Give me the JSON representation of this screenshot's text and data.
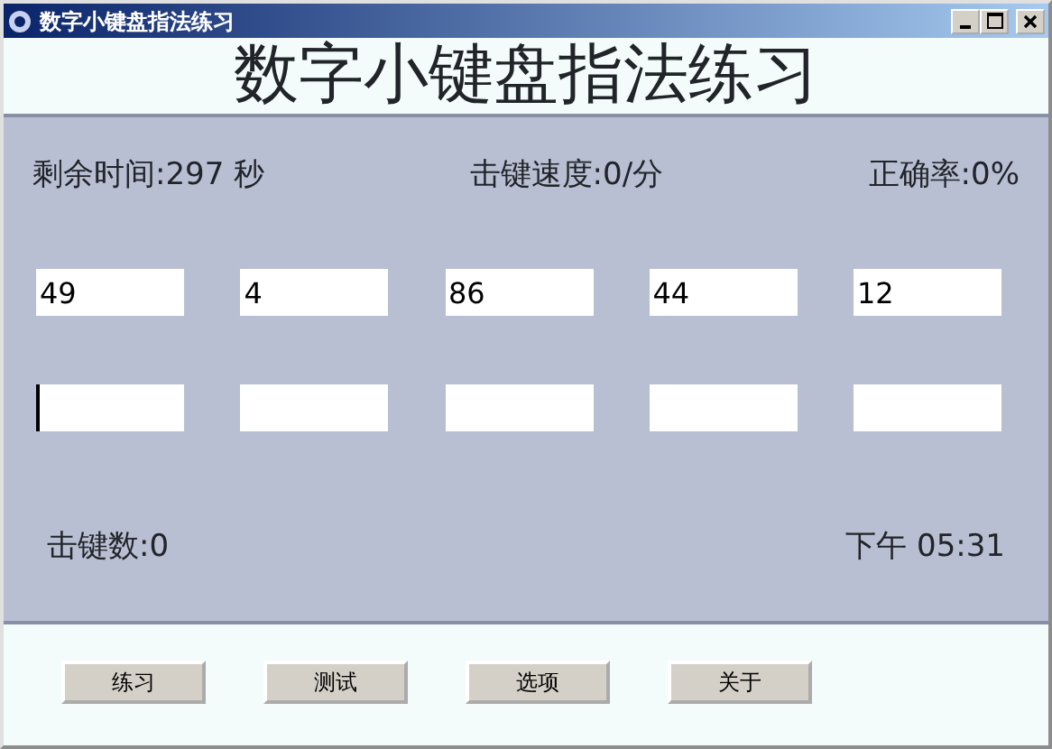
{
  "window": {
    "title": "数字小键盘指法练习"
  },
  "heading": "数字小键盘指法练习",
  "stats": [
    {
      "label": "剩余时间:297 秒"
    },
    {
      "label": "击键速度:0/分"
    },
    {
      "label": "正确率:0%"
    }
  ],
  "prompts": [
    "49",
    "4",
    "86",
    "44",
    "12"
  ],
  "answers": [
    {
      "focused": true
    },
    {
      "focused": false
    },
    {
      "focused": false
    },
    {
      "focused": false
    },
    {
      "focused": false
    }
  ],
  "keystrokes": "击键数:0",
  "clock": "下午 05:31",
  "buttons": [
    "练习",
    "测试",
    "选项",
    "关于"
  ]
}
